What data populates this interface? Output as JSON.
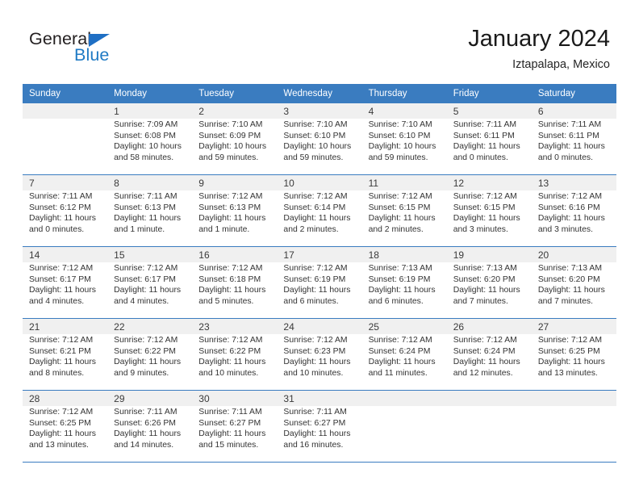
{
  "brand": {
    "name_top": "General",
    "name_bottom": "Blue",
    "triangle_color": "#1f6fc4",
    "blue_color": "#1f7ac4"
  },
  "header": {
    "title": "January 2024",
    "subtitle": "Iztapalapa, Mexico",
    "header_bg": "#3a7cc0"
  },
  "weekdays": [
    "Sunday",
    "Monday",
    "Tuesday",
    "Wednesday",
    "Thursday",
    "Friday",
    "Saturday"
  ],
  "weeks": [
    {
      "days": [
        {
          "num": "",
          "sunrise": "",
          "sunset": "",
          "daylight1": "",
          "daylight2": ""
        },
        {
          "num": "1",
          "sunrise": "Sunrise: 7:09 AM",
          "sunset": "Sunset: 6:08 PM",
          "daylight1": "Daylight: 10 hours",
          "daylight2": "and 58 minutes."
        },
        {
          "num": "2",
          "sunrise": "Sunrise: 7:10 AM",
          "sunset": "Sunset: 6:09 PM",
          "daylight1": "Daylight: 10 hours",
          "daylight2": "and 59 minutes."
        },
        {
          "num": "3",
          "sunrise": "Sunrise: 7:10 AM",
          "sunset": "Sunset: 6:10 PM",
          "daylight1": "Daylight: 10 hours",
          "daylight2": "and 59 minutes."
        },
        {
          "num": "4",
          "sunrise": "Sunrise: 7:10 AM",
          "sunset": "Sunset: 6:10 PM",
          "daylight1": "Daylight: 10 hours",
          "daylight2": "and 59 minutes."
        },
        {
          "num": "5",
          "sunrise": "Sunrise: 7:11 AM",
          "sunset": "Sunset: 6:11 PM",
          "daylight1": "Daylight: 11 hours",
          "daylight2": "and 0 minutes."
        },
        {
          "num": "6",
          "sunrise": "Sunrise: 7:11 AM",
          "sunset": "Sunset: 6:11 PM",
          "daylight1": "Daylight: 11 hours",
          "daylight2": "and 0 minutes."
        }
      ]
    },
    {
      "days": [
        {
          "num": "7",
          "sunrise": "Sunrise: 7:11 AM",
          "sunset": "Sunset: 6:12 PM",
          "daylight1": "Daylight: 11 hours",
          "daylight2": "and 0 minutes."
        },
        {
          "num": "8",
          "sunrise": "Sunrise: 7:11 AM",
          "sunset": "Sunset: 6:13 PM",
          "daylight1": "Daylight: 11 hours",
          "daylight2": "and 1 minute."
        },
        {
          "num": "9",
          "sunrise": "Sunrise: 7:12 AM",
          "sunset": "Sunset: 6:13 PM",
          "daylight1": "Daylight: 11 hours",
          "daylight2": "and 1 minute."
        },
        {
          "num": "10",
          "sunrise": "Sunrise: 7:12 AM",
          "sunset": "Sunset: 6:14 PM",
          "daylight1": "Daylight: 11 hours",
          "daylight2": "and 2 minutes."
        },
        {
          "num": "11",
          "sunrise": "Sunrise: 7:12 AM",
          "sunset": "Sunset: 6:15 PM",
          "daylight1": "Daylight: 11 hours",
          "daylight2": "and 2 minutes."
        },
        {
          "num": "12",
          "sunrise": "Sunrise: 7:12 AM",
          "sunset": "Sunset: 6:15 PM",
          "daylight1": "Daylight: 11 hours",
          "daylight2": "and 3 minutes."
        },
        {
          "num": "13",
          "sunrise": "Sunrise: 7:12 AM",
          "sunset": "Sunset: 6:16 PM",
          "daylight1": "Daylight: 11 hours",
          "daylight2": "and 3 minutes."
        }
      ]
    },
    {
      "days": [
        {
          "num": "14",
          "sunrise": "Sunrise: 7:12 AM",
          "sunset": "Sunset: 6:17 PM",
          "daylight1": "Daylight: 11 hours",
          "daylight2": "and 4 minutes."
        },
        {
          "num": "15",
          "sunrise": "Sunrise: 7:12 AM",
          "sunset": "Sunset: 6:17 PM",
          "daylight1": "Daylight: 11 hours",
          "daylight2": "and 4 minutes."
        },
        {
          "num": "16",
          "sunrise": "Sunrise: 7:12 AM",
          "sunset": "Sunset: 6:18 PM",
          "daylight1": "Daylight: 11 hours",
          "daylight2": "and 5 minutes."
        },
        {
          "num": "17",
          "sunrise": "Sunrise: 7:12 AM",
          "sunset": "Sunset: 6:19 PM",
          "daylight1": "Daylight: 11 hours",
          "daylight2": "and 6 minutes."
        },
        {
          "num": "18",
          "sunrise": "Sunrise: 7:13 AM",
          "sunset": "Sunset: 6:19 PM",
          "daylight1": "Daylight: 11 hours",
          "daylight2": "and 6 minutes."
        },
        {
          "num": "19",
          "sunrise": "Sunrise: 7:13 AM",
          "sunset": "Sunset: 6:20 PM",
          "daylight1": "Daylight: 11 hours",
          "daylight2": "and 7 minutes."
        },
        {
          "num": "20",
          "sunrise": "Sunrise: 7:13 AM",
          "sunset": "Sunset: 6:20 PM",
          "daylight1": "Daylight: 11 hours",
          "daylight2": "and 7 minutes."
        }
      ]
    },
    {
      "days": [
        {
          "num": "21",
          "sunrise": "Sunrise: 7:12 AM",
          "sunset": "Sunset: 6:21 PM",
          "daylight1": "Daylight: 11 hours",
          "daylight2": "and 8 minutes."
        },
        {
          "num": "22",
          "sunrise": "Sunrise: 7:12 AM",
          "sunset": "Sunset: 6:22 PM",
          "daylight1": "Daylight: 11 hours",
          "daylight2": "and 9 minutes."
        },
        {
          "num": "23",
          "sunrise": "Sunrise: 7:12 AM",
          "sunset": "Sunset: 6:22 PM",
          "daylight1": "Daylight: 11 hours",
          "daylight2": "and 10 minutes."
        },
        {
          "num": "24",
          "sunrise": "Sunrise: 7:12 AM",
          "sunset": "Sunset: 6:23 PM",
          "daylight1": "Daylight: 11 hours",
          "daylight2": "and 10 minutes."
        },
        {
          "num": "25",
          "sunrise": "Sunrise: 7:12 AM",
          "sunset": "Sunset: 6:24 PM",
          "daylight1": "Daylight: 11 hours",
          "daylight2": "and 11 minutes."
        },
        {
          "num": "26",
          "sunrise": "Sunrise: 7:12 AM",
          "sunset": "Sunset: 6:24 PM",
          "daylight1": "Daylight: 11 hours",
          "daylight2": "and 12 minutes."
        },
        {
          "num": "27",
          "sunrise": "Sunrise: 7:12 AM",
          "sunset": "Sunset: 6:25 PM",
          "daylight1": "Daylight: 11 hours",
          "daylight2": "and 13 minutes."
        }
      ]
    },
    {
      "days": [
        {
          "num": "28",
          "sunrise": "Sunrise: 7:12 AM",
          "sunset": "Sunset: 6:25 PM",
          "daylight1": "Daylight: 11 hours",
          "daylight2": "and 13 minutes."
        },
        {
          "num": "29",
          "sunrise": "Sunrise: 7:11 AM",
          "sunset": "Sunset: 6:26 PM",
          "daylight1": "Daylight: 11 hours",
          "daylight2": "and 14 minutes."
        },
        {
          "num": "30",
          "sunrise": "Sunrise: 7:11 AM",
          "sunset": "Sunset: 6:27 PM",
          "daylight1": "Daylight: 11 hours",
          "daylight2": "and 15 minutes."
        },
        {
          "num": "31",
          "sunrise": "Sunrise: 7:11 AM",
          "sunset": "Sunset: 6:27 PM",
          "daylight1": "Daylight: 11 hours",
          "daylight2": "and 16 minutes."
        },
        {
          "num": "",
          "sunrise": "",
          "sunset": "",
          "daylight1": "",
          "daylight2": ""
        },
        {
          "num": "",
          "sunrise": "",
          "sunset": "",
          "daylight1": "",
          "daylight2": ""
        },
        {
          "num": "",
          "sunrise": "",
          "sunset": "",
          "daylight1": "",
          "daylight2": ""
        }
      ]
    }
  ]
}
